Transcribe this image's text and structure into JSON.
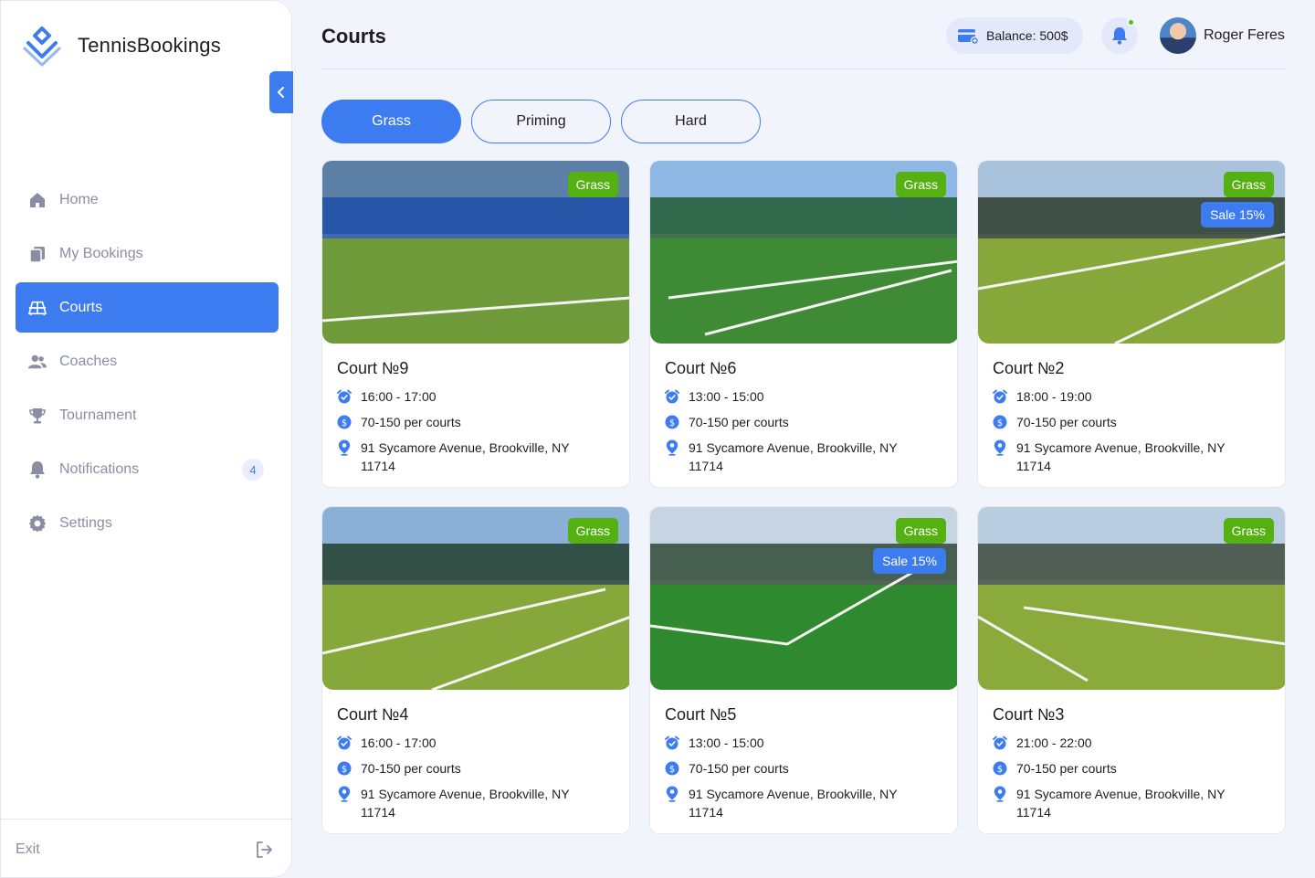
{
  "brand": {
    "name": "TennisBookings"
  },
  "sidebar": {
    "items": [
      {
        "label": "Home",
        "icon": "home-icon",
        "active": false
      },
      {
        "label": "My Bookings",
        "icon": "bookings-icon",
        "active": false
      },
      {
        "label": "Courts",
        "icon": "court-icon",
        "active": true
      },
      {
        "label": "Coaches",
        "icon": "users-icon",
        "active": false
      },
      {
        "label": "Tournament",
        "icon": "trophy-icon",
        "active": false
      },
      {
        "label": "Notifications",
        "icon": "bell-icon",
        "active": false,
        "badge": "4"
      },
      {
        "label": "Settings",
        "icon": "gear-icon",
        "active": false
      }
    ],
    "exit_label": "Exit"
  },
  "header": {
    "title": "Courts",
    "balance": "Balance: 500$",
    "user_name": "Roger Feres"
  },
  "filters": [
    {
      "label": "Grass",
      "active": true
    },
    {
      "label": "Priming",
      "active": false
    },
    {
      "label": "Hard",
      "active": false
    }
  ],
  "courts": [
    {
      "name": "Court №9",
      "tag": "Grass",
      "sale": "",
      "time": "16:00 - 17:00",
      "price": "70-150 per courts",
      "address_line1": "91 Sycamore Avenue, Brookville, NY",
      "address_line2": "11714"
    },
    {
      "name": "Court №6",
      "tag": "Grass",
      "sale": "",
      "time": "13:00 - 15:00",
      "price": "70-150 per courts",
      "address_line1": "91 Sycamore Avenue, Brookville, NY",
      "address_line2": "11714"
    },
    {
      "name": "Court №2",
      "tag": "Grass",
      "sale": "Sale 15%",
      "time": "18:00 - 19:00",
      "price": "70-150 per courts",
      "address_line1": "91 Sycamore Avenue, Brookville, NY",
      "address_line2": "11714"
    },
    {
      "name": "Court №4",
      "tag": "Grass",
      "sale": "",
      "time": "16:00 - 17:00",
      "price": "70-150 per courts",
      "address_line1": "91 Sycamore Avenue, Brookville, NY",
      "address_line2": "11714"
    },
    {
      "name": "Court №5",
      "tag": "Grass",
      "sale": "Sale 15%",
      "time": "13:00 - 15:00",
      "price": "70-150 per courts",
      "address_line1": "91 Sycamore Avenue, Brookville, NY",
      "address_line2": "11714"
    },
    {
      "name": "Court №3",
      "tag": "Grass",
      "sale": "",
      "time": "21:00 - 22:00",
      "price": "70-150 per courts",
      "address_line1": "91 Sycamore Avenue, Brookville, NY",
      "address_line2": "11714"
    }
  ],
  "colors": {
    "accent": "#3d7cf0",
    "grass_tag": "#55b112",
    "notification_dot": "#4fc21f"
  }
}
